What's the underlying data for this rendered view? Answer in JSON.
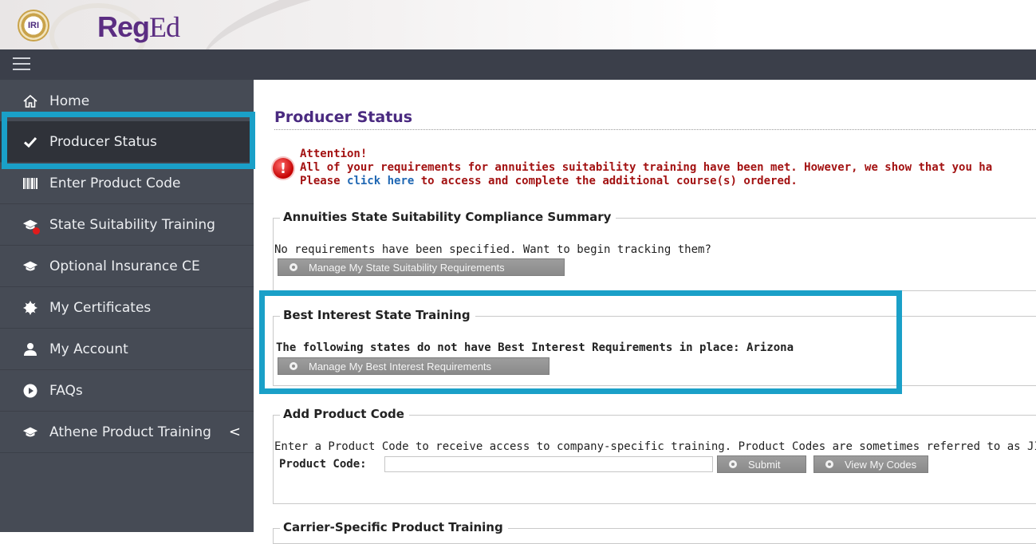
{
  "header": {
    "logo_badge": "IRI",
    "brand_main": "Reg",
    "brand_suffix": "Ed"
  },
  "sidebar": {
    "items": [
      {
        "label": "Home",
        "icon": "home-icon"
      },
      {
        "label": "Producer Status",
        "icon": "check-icon",
        "active": true
      },
      {
        "label": "Enter Product Code",
        "icon": "barcode-icon"
      },
      {
        "label": "State Suitability Training",
        "icon": "graduation-cap-icon",
        "badge": "red-dot"
      },
      {
        "label": "Optional Insurance CE",
        "icon": "graduation-cap-icon"
      },
      {
        "label": "My Certificates",
        "icon": "certificate-icon"
      },
      {
        "label": "My Account",
        "icon": "user-icon"
      },
      {
        "label": "FAQs",
        "icon": "play-circle-icon"
      },
      {
        "label": "Athene Product Training",
        "icon": "graduation-cap-icon",
        "chevron": "<"
      }
    ]
  },
  "main": {
    "title": "Producer Status",
    "alert": {
      "heading": "Attention!",
      "line1": "All of your requirements for annuities suitability training have been met. However, we show that you ha",
      "line2_prefix": "Please ",
      "line2_link": "click here",
      "line2_suffix": " to access and complete the additional course(s) ordered."
    },
    "suitability": {
      "legend": "Annuities State Suitability Compliance Summary",
      "text": "No requirements have been specified. Want to begin tracking them?",
      "button": "Manage My State Suitability Requirements"
    },
    "best_interest": {
      "legend": "Best Interest State Training",
      "text": "The following states do not have Best Interest Requirements in place: Arizona",
      "button": "Manage My Best Interest Requirements"
    },
    "product_code": {
      "legend": "Add Product Code",
      "text": "Enter a Product Code to receive access to company-specific training. Product Codes are sometimes referred to as JIT co",
      "field_label": "Product Code:",
      "field_value": "",
      "submit": "Submit",
      "view_codes": "View My Codes"
    },
    "carrier": {
      "legend": "Carrier-Specific Product Training"
    }
  },
  "colors": {
    "highlight": "#1aa0c8",
    "sidebar_bg": "#464b55",
    "title": "#4a2a80",
    "alert": "#a31212",
    "link": "#1f67b3"
  }
}
